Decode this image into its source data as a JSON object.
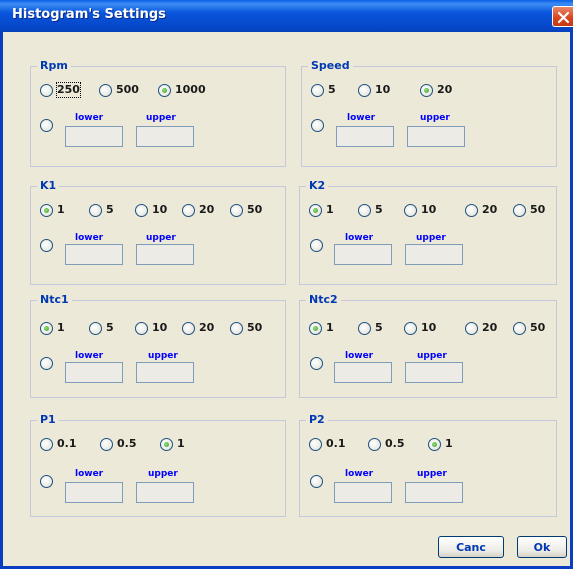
{
  "window": {
    "title": "Histogram's Settings"
  },
  "lower_label": "lower",
  "upper_label": "upper",
  "groups": {
    "rpm": {
      "title": "Rpm",
      "options": [
        "250",
        "500",
        "1000"
      ],
      "selected": "1000"
    },
    "speed": {
      "title": "Speed",
      "options": [
        "5",
        "10",
        "20"
      ],
      "selected": "20"
    },
    "k1": {
      "title": "K1",
      "options": [
        "1",
        "5",
        "10",
        "20",
        "50"
      ],
      "selected": "1"
    },
    "k2": {
      "title": "K2",
      "options": [
        "1",
        "5",
        "10",
        "20",
        "50"
      ],
      "selected": "1"
    },
    "ntc1": {
      "title": "Ntc1",
      "options": [
        "1",
        "5",
        "10",
        "20",
        "50"
      ],
      "selected": "1"
    },
    "ntc2": {
      "title": "Ntc2",
      "options": [
        "1",
        "5",
        "10",
        "20",
        "50"
      ],
      "selected": "1"
    },
    "p1": {
      "title": "P1",
      "options": [
        "0.1",
        "0.5",
        "1"
      ],
      "selected": "1"
    },
    "p2": {
      "title": "P2",
      "options": [
        "0.1",
        "0.5",
        "1"
      ],
      "selected": "1"
    }
  },
  "buttons": {
    "cancel": "Canc",
    "ok": "Ok"
  }
}
